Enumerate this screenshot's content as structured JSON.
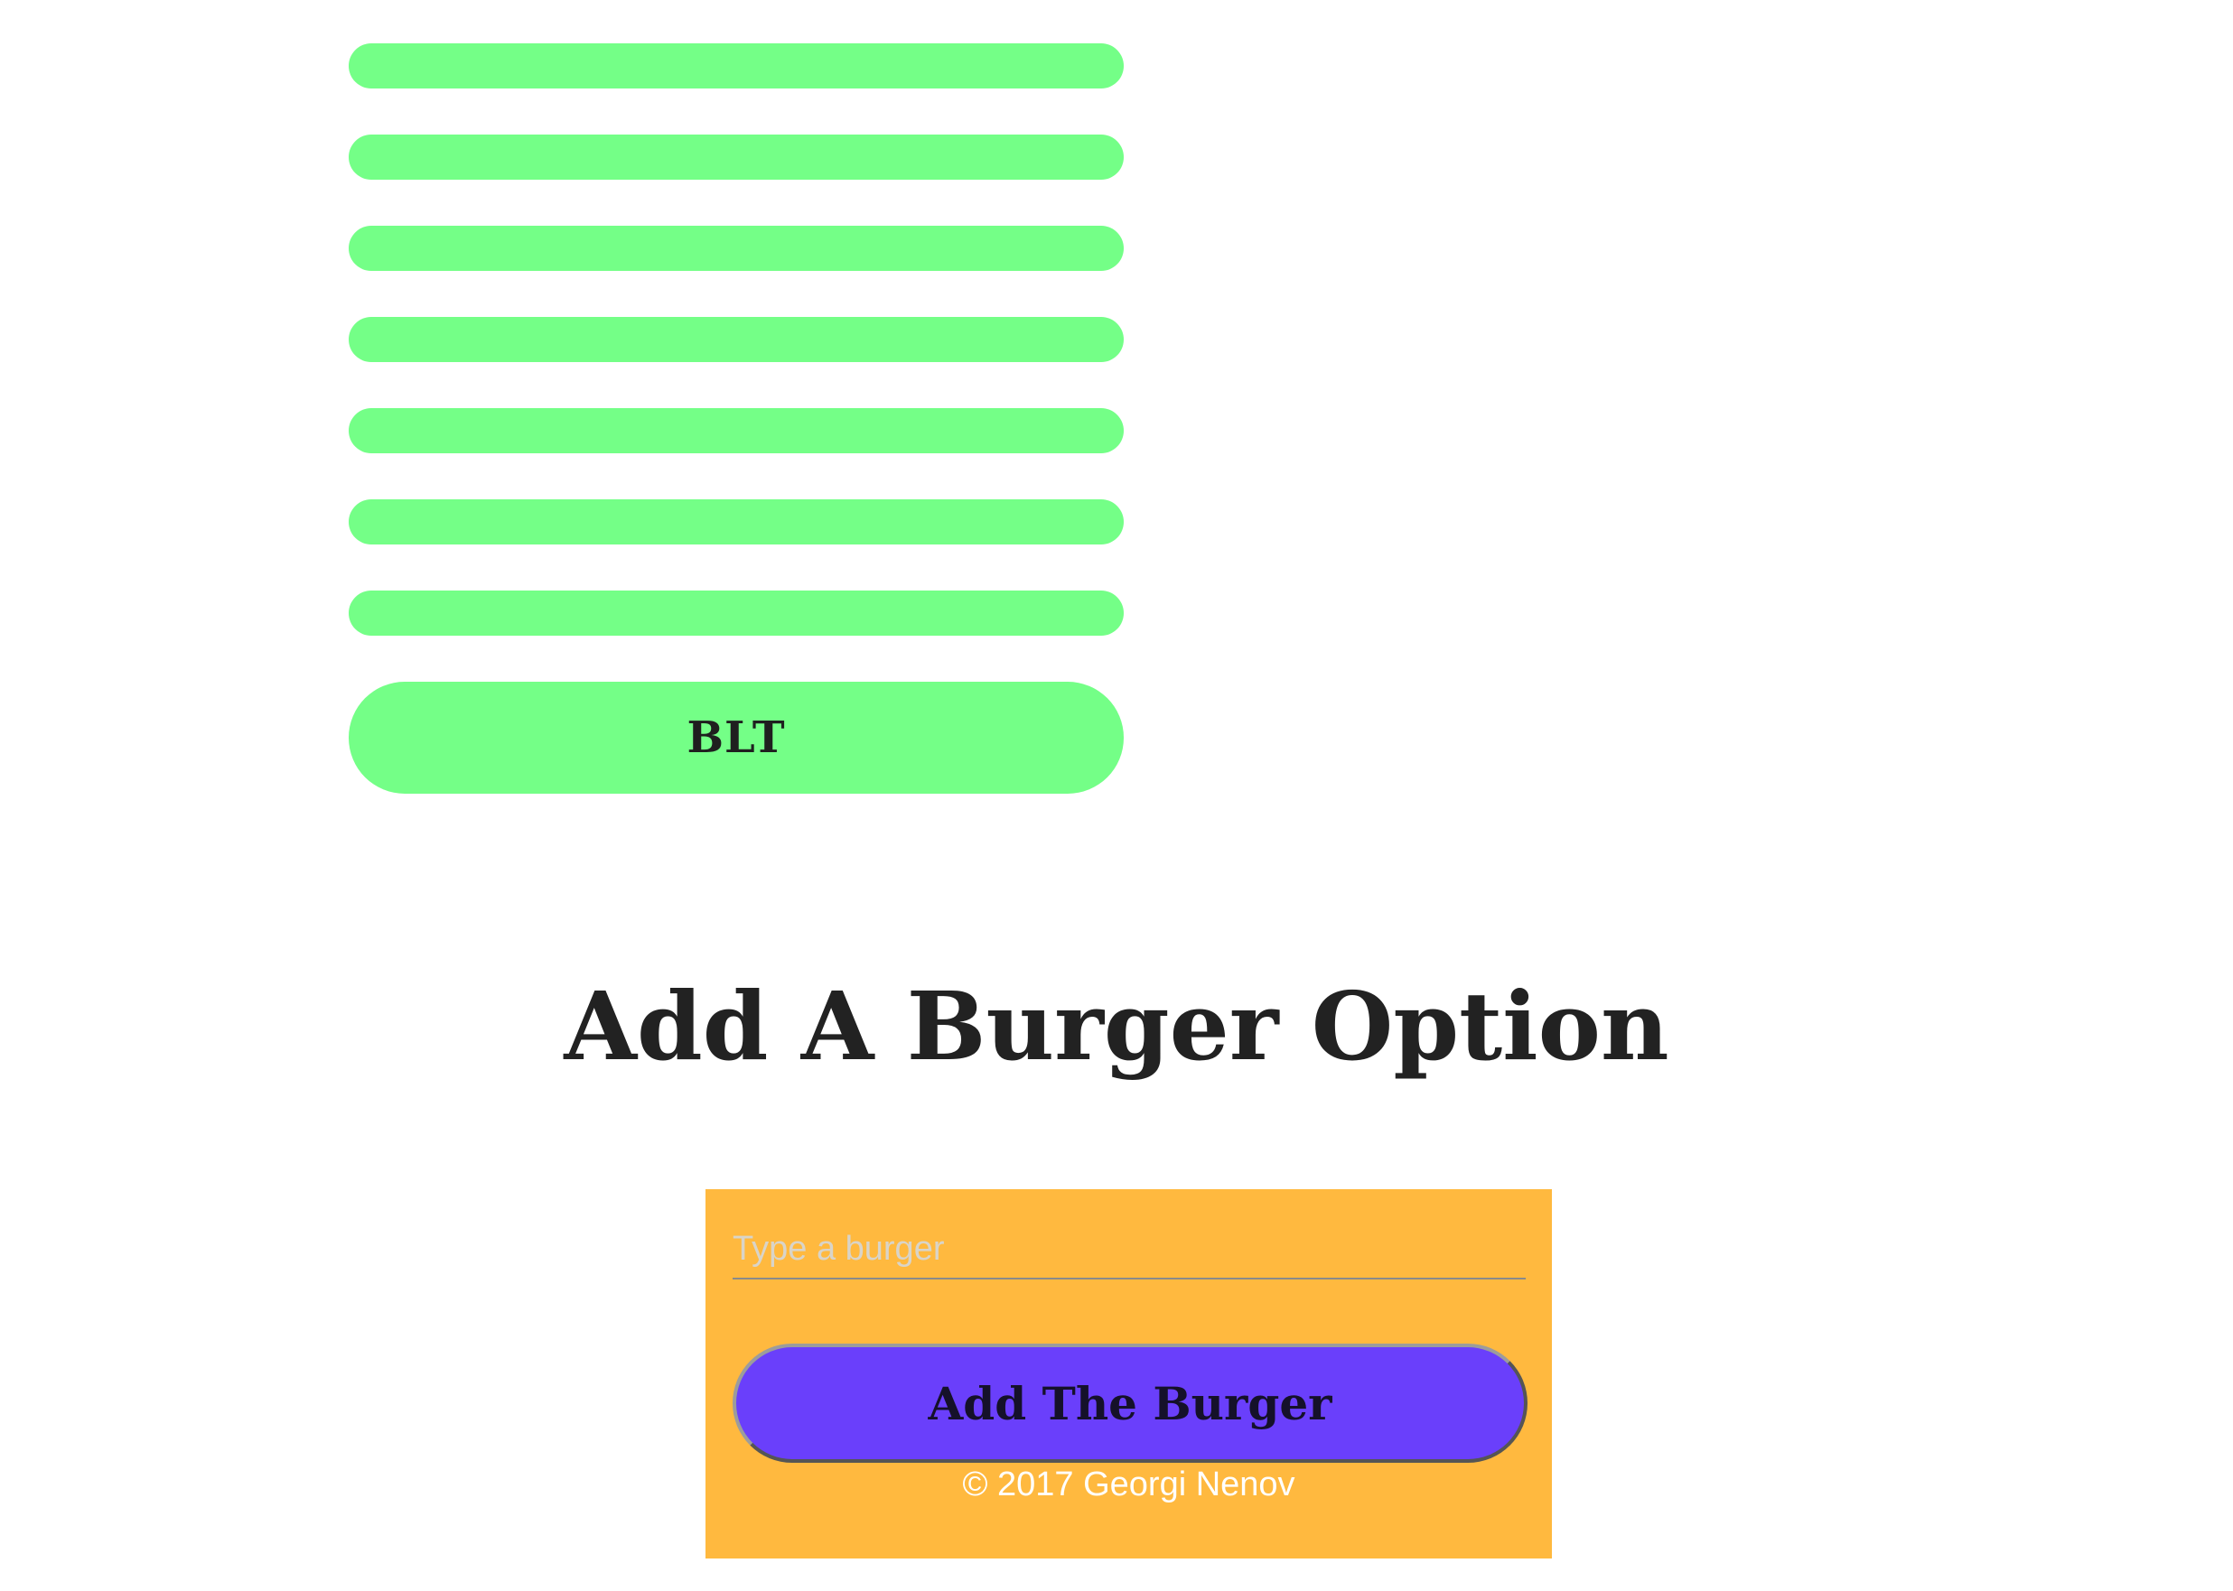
{
  "burger_list": {
    "items": [
      "",
      "",
      "",
      "",
      "",
      "",
      "",
      "BLT"
    ]
  },
  "add_section": {
    "title": "Add A Burger Option",
    "input_placeholder": "Type a burger",
    "input_value": "",
    "button_label": "Add The Burger"
  },
  "footer": {
    "copyright": "© 2017 Georgi Nenov"
  },
  "colors": {
    "burger_bar": "#74ff87",
    "panel": "#ffb93f",
    "button": "#6a3ffb",
    "title_text": "#222222"
  }
}
